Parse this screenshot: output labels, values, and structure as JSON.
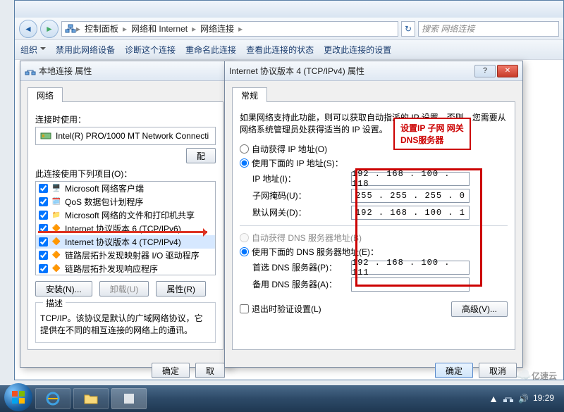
{
  "explorer": {
    "breadcrumb": [
      "控制面板",
      "网络和 Internet",
      "网络连接"
    ],
    "search_placeholder": "搜索 网络连接",
    "toolbar": [
      "组织",
      "禁用此网络设备",
      "诊断这个连接",
      "重命名此连接",
      "查看此连接的状态",
      "更改此连接的设置"
    ]
  },
  "lan_dlg": {
    "title": "本地连接 属性",
    "tab": "网络",
    "connect_using_label": "连接时使用：",
    "adapter": "Intel(R) PRO/1000 MT Network Connecti",
    "config_btn": "配",
    "items_label": "此连接使用下列项目(O)：",
    "items": [
      {
        "checked": true,
        "label": "Microsoft 网络客户端"
      },
      {
        "checked": true,
        "label": "QoS 数据包计划程序"
      },
      {
        "checked": true,
        "label": "Microsoft 网络的文件和打印机共享"
      },
      {
        "checked": true,
        "label": "Internet 协议版本 6 (TCP/IPv6)"
      },
      {
        "checked": true,
        "label": "Internet 协议版本 4 (TCP/IPv4)"
      },
      {
        "checked": true,
        "label": "链路层拓扑发现映射器 I/O 驱动程序"
      },
      {
        "checked": true,
        "label": "链路层拓扑发现响应程序"
      }
    ],
    "install_btn": "安装(N)...",
    "uninstall_btn": "卸载(U)",
    "properties_btn": "属性(R)",
    "desc_title": "描述",
    "desc_text": "TCP/IP。该协议是默认的广域网络协议，它提供在不同的相互连接的网络上的通讯。",
    "ok_btn": "确定",
    "cancel_btn": "取"
  },
  "ipv4_dlg": {
    "title": "Internet 协议版本 4 (TCP/IPv4) 属性",
    "tab": "常规",
    "instruction": "如果网络支持此功能，则可以获取自动指派的 IP 设置。否则，您需要从网络系统管理员处获得适当的 IP 设置。",
    "auto_ip": "自动获得 IP 地址(O)",
    "use_ip": "使用下面的 IP 地址(S)：",
    "ip_label": "IP 地址(I)：",
    "ip_value": "192 . 168 . 100 . 118",
    "subnet_label": "子网掩码(U)：",
    "subnet_value": "255 . 255 . 255 .  0",
    "gateway_label": "默认网关(D)：",
    "gateway_value": "192 . 168 . 100 .  1",
    "auto_dns": "自动获得 DNS 服务器地址(B)",
    "use_dns": "使用下面的 DNS 服务器地址(E)：",
    "pref_dns_label": "首选 DNS 服务器(P)：",
    "pref_dns_value": "192 . 168 . 100 . 111",
    "alt_dns_label": "备用 DNS 服务器(A)：",
    "alt_dns_value": "",
    "validate_label": "退出时验证设置(L)",
    "advanced_btn": "高级(V)...",
    "ok_btn": "确定",
    "cancel_btn": "取消"
  },
  "callout": {
    "line1": "设置IP 子网 网关",
    "line2": "DNS服务器"
  },
  "taskbar": {
    "time": "19:29"
  },
  "watermark": "亿速云"
}
